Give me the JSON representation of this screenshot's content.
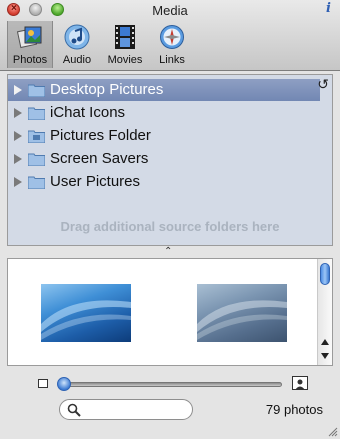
{
  "window": {
    "title": "Media",
    "info_icon": "i"
  },
  "toolbar": {
    "items": [
      {
        "label": "Photos",
        "icon": "photos-icon",
        "selected": true
      },
      {
        "label": "Audio",
        "icon": "audio-icon",
        "selected": false
      },
      {
        "label": "Movies",
        "icon": "movies-icon",
        "selected": false
      },
      {
        "label": "Links",
        "icon": "links-icon",
        "selected": false
      }
    ]
  },
  "sources": {
    "items": [
      {
        "label": "Desktop Pictures",
        "selected": true
      },
      {
        "label": "iChat Icons",
        "selected": false
      },
      {
        "label": "Pictures Folder",
        "selected": false
      },
      {
        "label": "Screen Savers",
        "selected": false
      },
      {
        "label": "User Pictures",
        "selected": false
      }
    ],
    "hint": "Drag additional source folders here"
  },
  "browser": {
    "thumbnails": [
      "thumbnail-blue-wave",
      "thumbnail-gray-wave"
    ]
  },
  "footer": {
    "search_placeholder": "",
    "count": "79 photos"
  },
  "colors": {
    "selection": "#7a8db6",
    "source_bg": "#d3dae6",
    "accent": "#3c7ad2"
  }
}
